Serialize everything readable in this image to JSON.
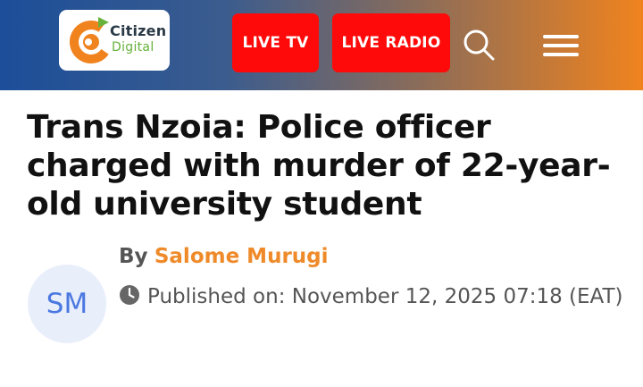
{
  "header": {
    "logo": {
      "line1": "Citizen",
      "line2": "Digital"
    },
    "live_tv_label": "LIVE TV",
    "live_radio_label": "LIVE RADIO",
    "search_icon": "search-icon",
    "menu_icon": "hamburger-menu-icon",
    "colors": {
      "gradient_left": "#1c4e99",
      "gradient_right": "#f0831e",
      "button_red": "#ff0a0a"
    }
  },
  "article": {
    "title": "Trans Nzoia: Police officer charged with murder of 22-year-old university student",
    "byline_prefix": "By",
    "author": "Salome Murugi",
    "author_initials": "SM",
    "published_label": "Published on:",
    "published_date": "November 12, 2025 07:18 (EAT)",
    "clock_icon": "clock-icon",
    "colors": {
      "author": "#ef8a2a",
      "avatar_bg": "#e9eefb",
      "avatar_text": "#4a78e0"
    }
  }
}
